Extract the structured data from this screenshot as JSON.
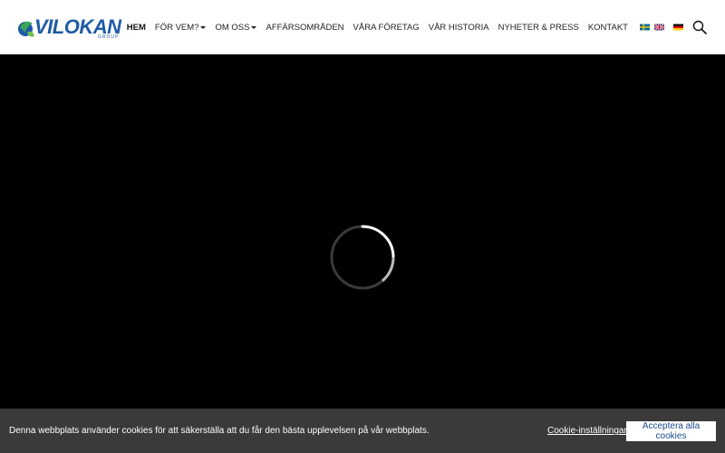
{
  "brand": {
    "name": "VILOKAN",
    "sub": "GROUP"
  },
  "nav": {
    "items": [
      {
        "label": "HEM",
        "active": true,
        "dropdown": false
      },
      {
        "label": "FÖR VEM?",
        "active": false,
        "dropdown": true
      },
      {
        "label": "OM OSS",
        "active": false,
        "dropdown": true
      },
      {
        "label": "AFFÄRSOMRÅDEN",
        "active": false,
        "dropdown": false
      },
      {
        "label": "VÅRA FÖRETAG",
        "active": false,
        "dropdown": false
      },
      {
        "label": "VÅR HISTORIA",
        "active": false,
        "dropdown": false
      },
      {
        "label": "NYHETER & PRESS",
        "active": false,
        "dropdown": false
      },
      {
        "label": "KONTAKT",
        "active": false,
        "dropdown": false
      }
    ]
  },
  "flags": [
    "swedish-flag-icon",
    "uk-flag-icon",
    "german-flag-icon"
  ],
  "icons": {
    "search": "search-icon",
    "spinner": "loading-spinner-icon"
  },
  "cookie": {
    "text": "Denna webbplats använder cookies för att säkerställa att du får den bästa upplevelsen på vår webbplats.",
    "settings_label": "Cookie-inställningar",
    "accept_label": "Acceptera alla cookies"
  },
  "colors": {
    "brand_blue": "#1f5aa6",
    "cookie_bg": "#3a3a3a",
    "accept_text": "#1c4b8f"
  }
}
